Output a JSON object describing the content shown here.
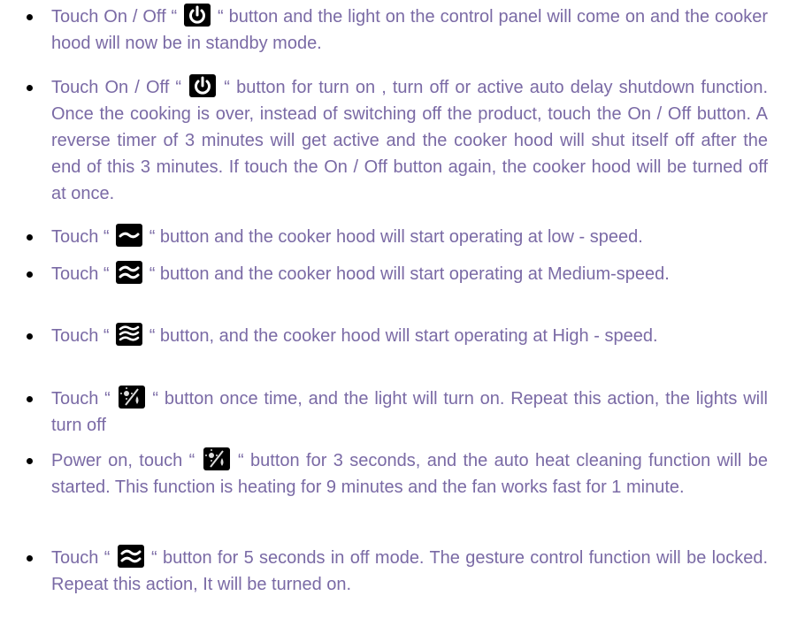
{
  "bullets": [
    {
      "before": "Touch On / Off  “",
      "icon": "power-icon",
      "after": "“  button and the light on the control panel will come on and the cooker hood will now be in standby mode."
    },
    {
      "before": "Touch On / Off  “",
      "icon": "power-icon",
      "after": "“  button for turn on , turn off or active auto delay shutdown function. Once the cooking is over, instead of switching off the product, touch the On / Off button. A reverse timer of 3 minutes will get active and the cooker hood will shut itself off after the end of this 3 minutes. If touch the On / Off button again, the cooker hood will be turned off at once."
    },
    {
      "before": "Touch  “",
      "icon": "low-speed-icon",
      "after": "“  button and the cooker hood will start operating at low - speed."
    },
    {
      "before": "Touch  “",
      "icon": "medium-speed-icon",
      "after": "“  button and the cooker hood will start operating at Medium-speed."
    },
    {
      "before": "Touch  “",
      "icon": "high-speed-icon",
      "after": "“  button, and the cooker hood will start operating at High - speed."
    },
    {
      "before": "Touch “",
      "icon": "light-clean-icon",
      "after": "“ button once time, and the light will turn on. Repeat this action, the lights will turn off"
    },
    {
      "before": "Power on, touch “",
      "icon": "light-clean-icon",
      "after": "“ button for 3 seconds, and the auto heat cleaning function will be started. This function is heating for 9 minutes and the fan works fast for 1 minute."
    },
    {
      "before": "Touch “",
      "icon": "medium-speed-icon",
      "after": "“ button for 5 seconds in off mode. The gesture control function will be locked. Repeat this action, It will be turned on."
    }
  ]
}
